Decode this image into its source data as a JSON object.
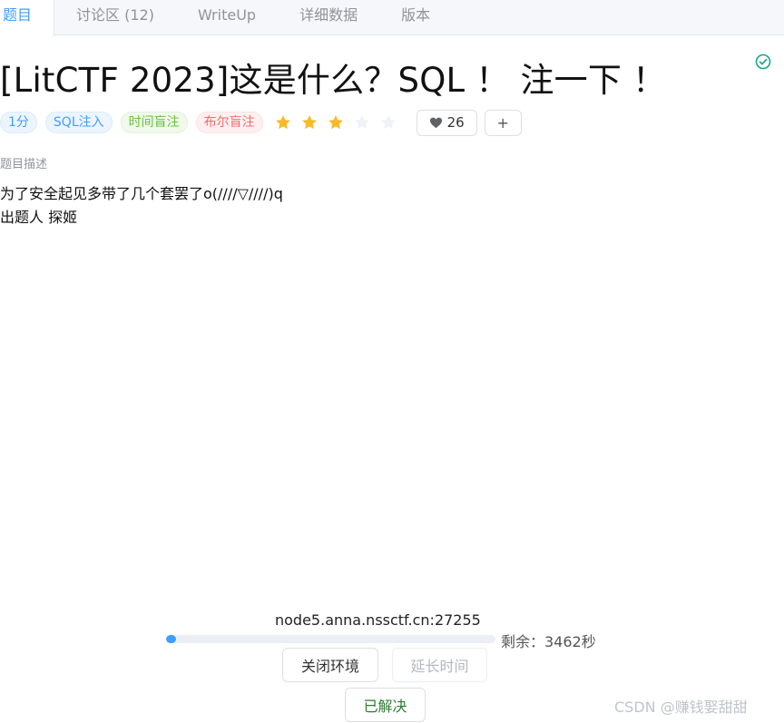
{
  "tabs": [
    {
      "label": "题目",
      "active": true
    },
    {
      "label": "讨论区 (12)",
      "active": false
    },
    {
      "label": "WriteUp",
      "active": false
    },
    {
      "label": "详细数据",
      "active": false
    },
    {
      "label": "版本",
      "active": false
    }
  ],
  "challenge": {
    "title": "[LitCTF 2023]这是什么？SQL ！ 注一下 ！",
    "solved": true,
    "tags": [
      "1分",
      "SQL注入",
      "时间盲注",
      "布尔盲注"
    ],
    "rating": {
      "filled": 3,
      "total": 5
    },
    "likes": "26",
    "add_label": "+",
    "description_label": "题目描述",
    "description_lines": [
      "为了安全起见多带了几个套罢了o(////▽////)q",
      "出题人 探姬"
    ]
  },
  "environment": {
    "host": "node5.anna.nssctf.cn:27255",
    "remaining_text": "剩余：3462秒",
    "progress_fraction": 0.03,
    "close_label": "关闭环境",
    "extend_label": "延长时间",
    "solved_label": "已解决"
  },
  "watermark": "CSDN @赚钱娶甜甜",
  "colors": {
    "accent": "#409eff",
    "star_filled": "#f7ba2a",
    "star_empty": "#eff2f7",
    "solved_check": "#13a883",
    "tag_blue": "#409eff",
    "tag_green": "#67c23a",
    "tag_red": "#f56c6c"
  }
}
